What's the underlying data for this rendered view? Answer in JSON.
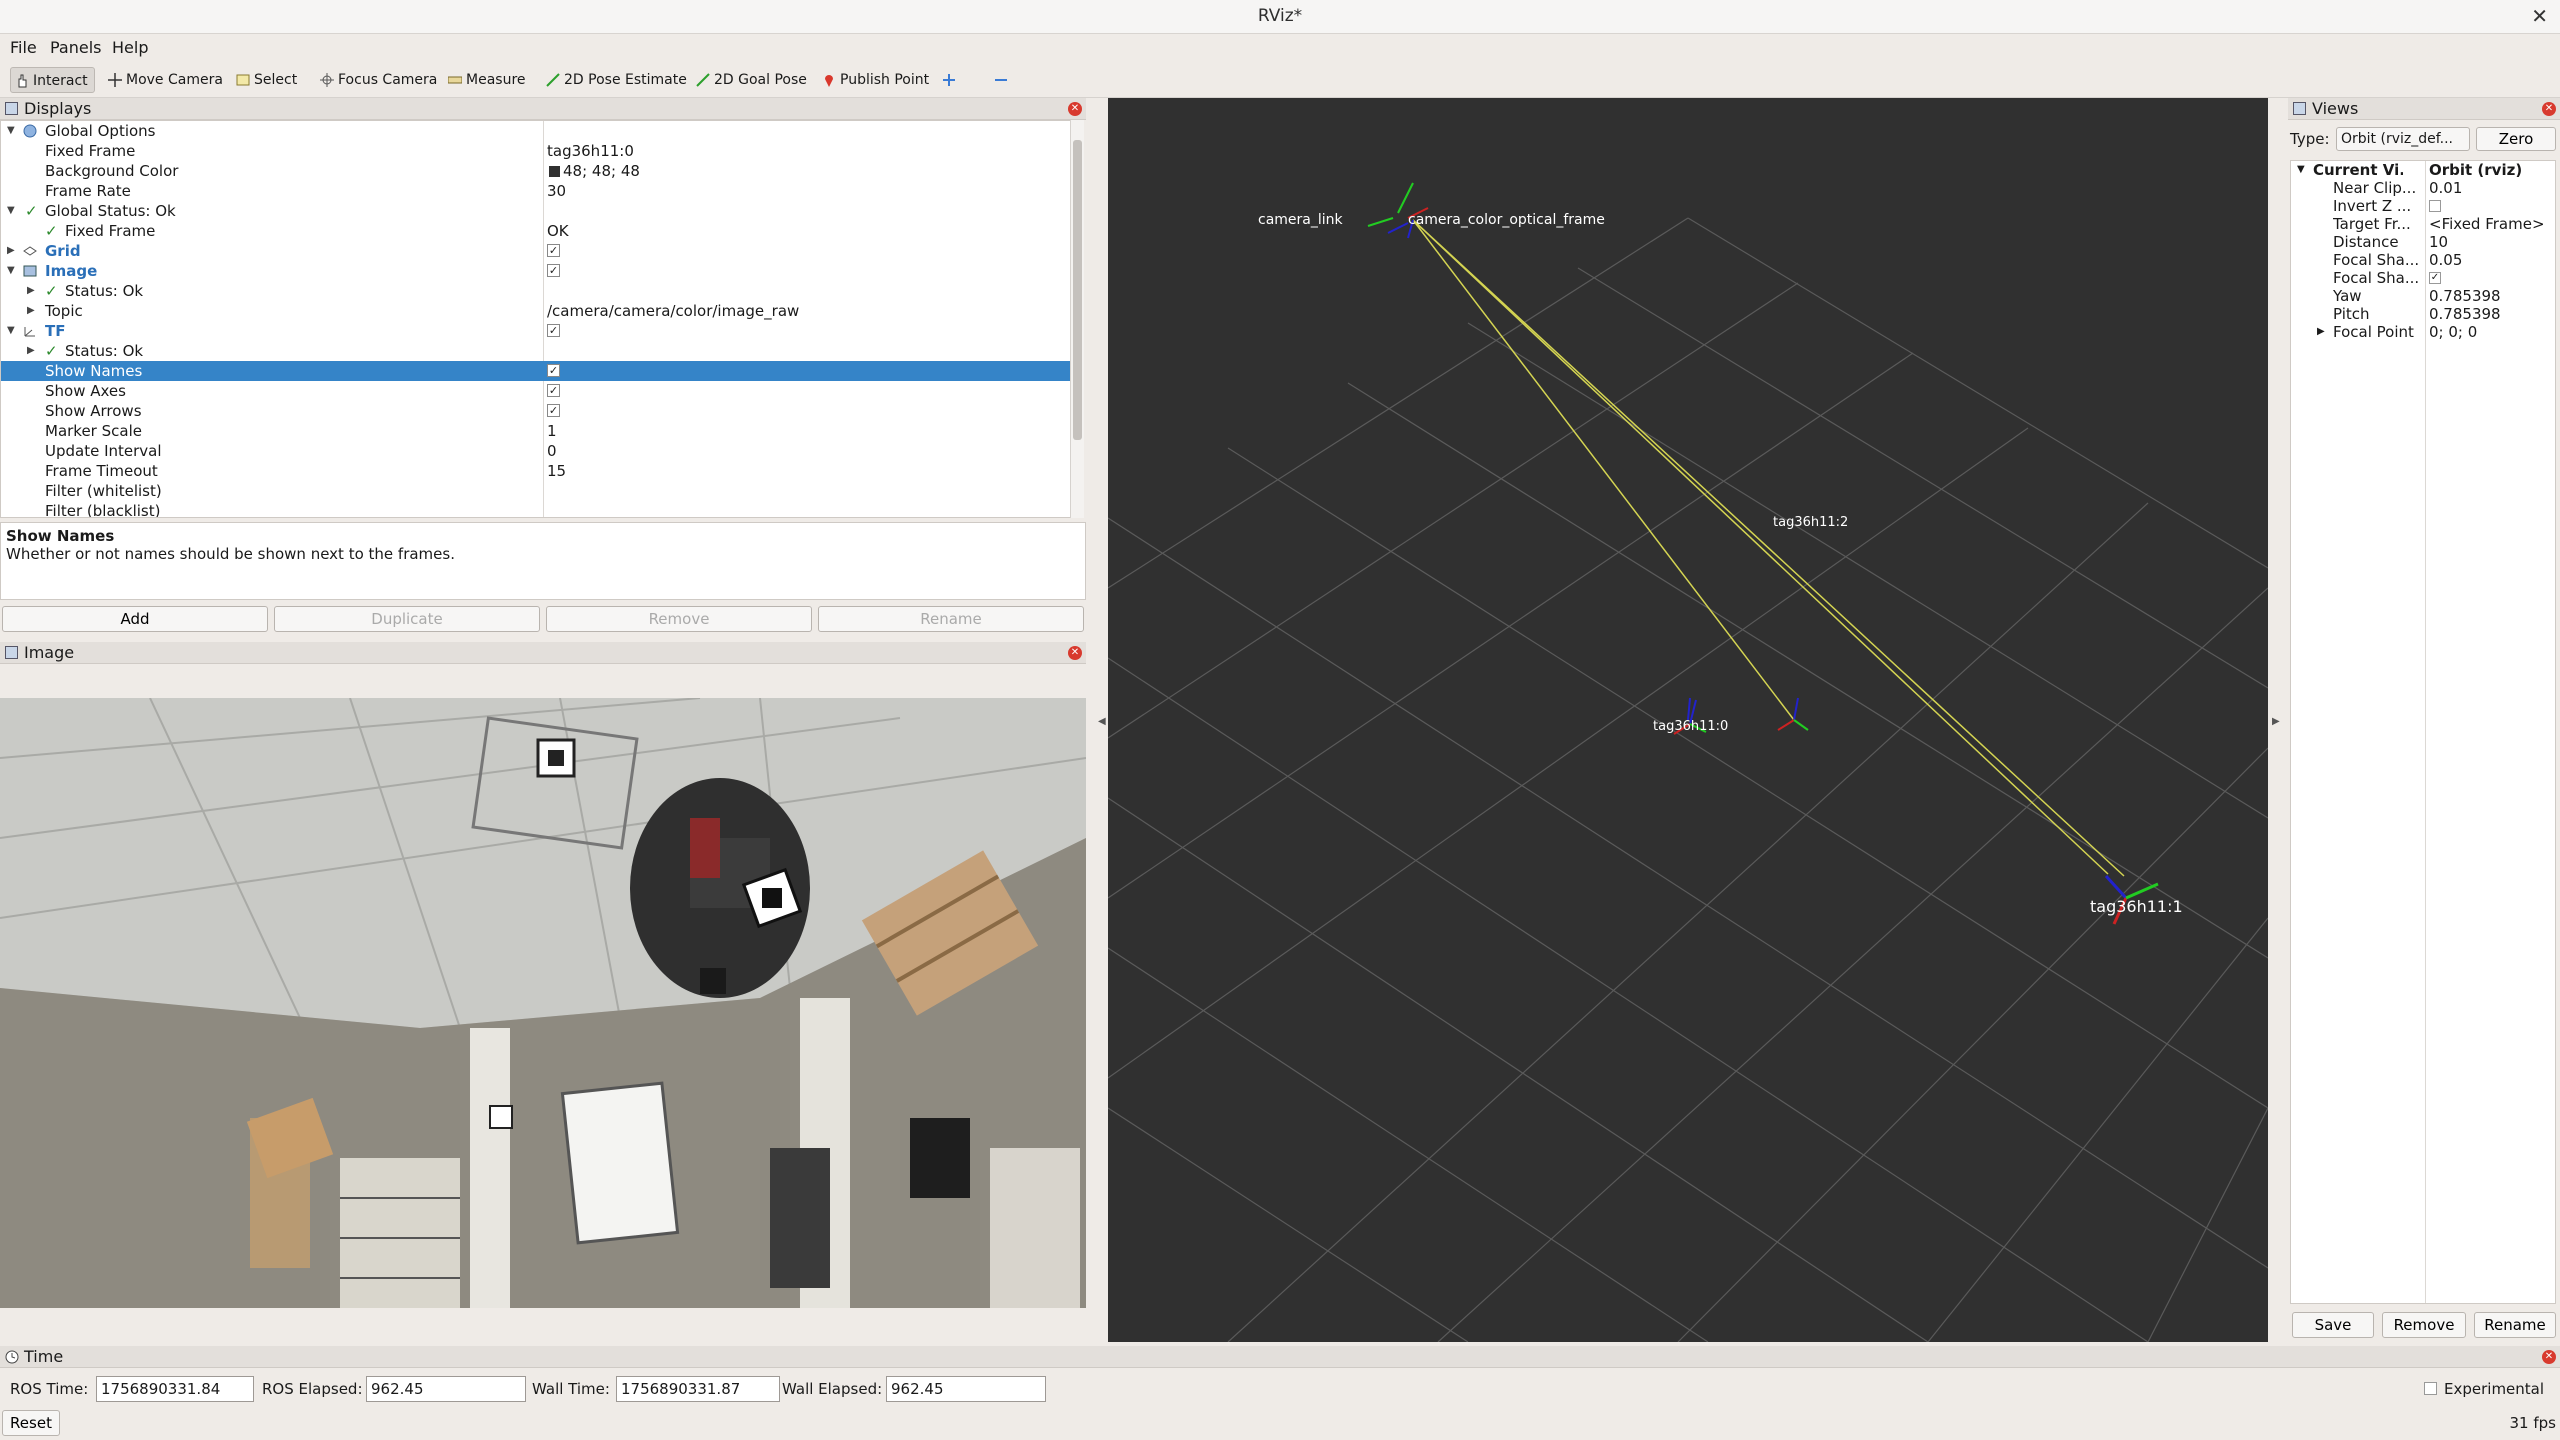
{
  "window": {
    "title": "RViz*"
  },
  "menu": [
    "File",
    "Panels",
    "Help"
  ],
  "toolbar": {
    "interact": "Interact",
    "move_camera": "Move Camera",
    "select": "Select",
    "focus_camera": "Focus Camera",
    "measure": "Measure",
    "pose_estimate": "2D Pose Estimate",
    "goal_pose": "2D Goal Pose",
    "publish_point": "Publish Point"
  },
  "displays": {
    "title": "Displays",
    "rows": [
      {
        "label": "Global Options",
        "value": ""
      },
      {
        "label": "Fixed Frame",
        "value": "tag36h11:0"
      },
      {
        "label": "Background Color",
        "value": "48; 48; 48"
      },
      {
        "label": "Frame Rate",
        "value": "30"
      },
      {
        "label": "Global Status: Ok",
        "value": ""
      },
      {
        "label": "Fixed Frame",
        "value": "OK"
      },
      {
        "label": "Grid",
        "value": ""
      },
      {
        "label": "Image",
        "value": ""
      },
      {
        "label": "Status: Ok",
        "value": ""
      },
      {
        "label": "Topic",
        "value": "/camera/camera/color/image_raw"
      },
      {
        "label": "TF",
        "value": ""
      },
      {
        "label": "Status: Ok",
        "value": ""
      },
      {
        "label": "Show Names",
        "value": ""
      },
      {
        "label": "Show Axes",
        "value": ""
      },
      {
        "label": "Show Arrows",
        "value": ""
      },
      {
        "label": "Marker Scale",
        "value": "1"
      },
      {
        "label": "Update Interval",
        "value": "0"
      },
      {
        "label": "Frame Timeout",
        "value": "15"
      },
      {
        "label": "Filter (whitelist)",
        "value": ""
      },
      {
        "label": "Filter (blacklist)",
        "value": ""
      }
    ],
    "desc_title": "Show Names",
    "desc_text": "Whether or not names should be shown next to the frames.",
    "buttons": {
      "add": "Add",
      "duplicate": "Duplicate",
      "remove": "Remove",
      "rename": "Rename"
    }
  },
  "image_panel": {
    "title": "Image"
  },
  "viewport": {
    "labels": {
      "camera": "camera_link",
      "optical": "camera_color_optical_frame",
      "tag0": "tag36h11:0",
      "tag1": "tag36h11:1",
      "tag2": "tag36h11:2"
    }
  },
  "views": {
    "title": "Views",
    "type_label": "Type:",
    "type_value": "Orbit (rviz_def...",
    "zero": "Zero",
    "rows": [
      {
        "label": "Current Vi...",
        "value": "Orbit (rviz)"
      },
      {
        "label": "Near Clip...",
        "value": "0.01"
      },
      {
        "label": "Invert Z ...",
        "value": ""
      },
      {
        "label": "Target Fr...",
        "value": "<Fixed Frame>"
      },
      {
        "label": "Distance",
        "value": "10"
      },
      {
        "label": "Focal Sha...",
        "value": "0.05"
      },
      {
        "label": "Focal Sha...",
        "value": ""
      },
      {
        "label": "Yaw",
        "value": "0.785398"
      },
      {
        "label": "Pitch",
        "value": "0.785398"
      },
      {
        "label": "Focal Point",
        "value": "0; 0; 0"
      }
    ],
    "buttons": {
      "save": "Save",
      "remove": "Remove",
      "rename": "Rename"
    }
  },
  "time": {
    "title": "Time",
    "ros_time_label": "ROS Time:",
    "ros_time": "1756890331.84",
    "ros_elapsed_label": "ROS Elapsed:",
    "ros_elapsed": "962.45",
    "wall_time_label": "Wall Time:",
    "wall_time": "1756890331.87",
    "wall_elapsed_label": "Wall Elapsed:",
    "wall_elapsed": "962.45",
    "experimental": "Experimental",
    "reset": "Reset",
    "fps": "31 fps"
  },
  "colors": {
    "background": "#303030",
    "selection": "#3584c8",
    "tf_link": "#d4d452"
  }
}
